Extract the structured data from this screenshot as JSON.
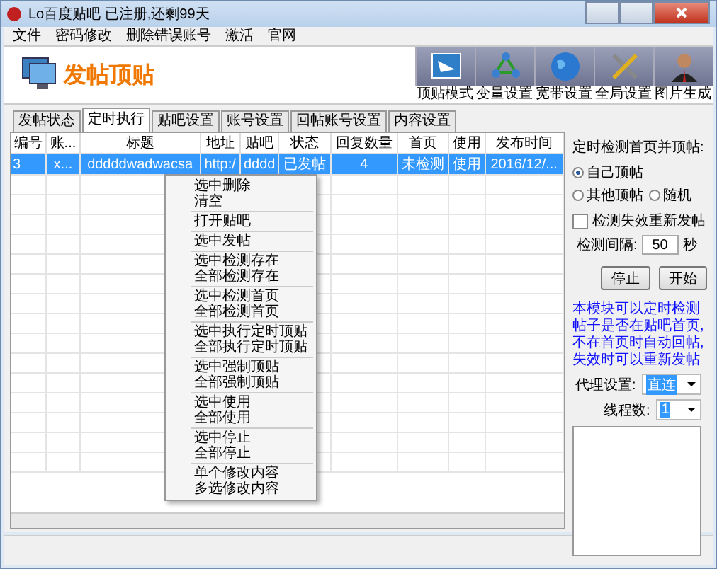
{
  "window": {
    "title": "Lo百度贴吧  已注册,还剩99天"
  },
  "menu": [
    "文件",
    "密码修改",
    "删除错误账号",
    "激活",
    "官网"
  ],
  "header": {
    "title": "发帖顶贴"
  },
  "toolbar": [
    {
      "label": "顶贴模式",
      "kind": "screen"
    },
    {
      "label": "变量设置",
      "kind": "network"
    },
    {
      "label": "宽带设置",
      "kind": "globe"
    },
    {
      "label": "全局设置",
      "kind": "tools"
    },
    {
      "label": "图片生成",
      "kind": "person"
    }
  ],
  "tabs": [
    {
      "label": "发帖状态",
      "selected": false
    },
    {
      "label": "定时执行",
      "selected": true
    },
    {
      "label": "贴吧设置",
      "selected": false
    },
    {
      "label": "账号设置",
      "selected": false
    },
    {
      "label": "回帖账号设置",
      "selected": false
    },
    {
      "label": "内容设置",
      "selected": false
    }
  ],
  "table": {
    "columns": [
      "编号",
      "账...",
      "标题",
      "地址",
      "贴吧",
      "状态",
      "回复数量",
      "首页",
      "使用",
      "发布时间"
    ],
    "rows": [
      {
        "selected": true,
        "cells": [
          "3",
          "x...",
          "dddddwadwacsa",
          "http:/",
          "dddd",
          "已发帖",
          "4",
          "未检测",
          "使用",
          "2016/12/..."
        ]
      }
    ]
  },
  "context_menu": [
    [
      "选中删除",
      "清空"
    ],
    [
      "打开贴吧"
    ],
    [
      "选中发帖"
    ],
    [
      "选中检测存在",
      "全部检测存在"
    ],
    [
      "选中检测首页",
      "全部检测首页"
    ],
    [
      "选中执行定时顶贴",
      "全部执行定时顶贴"
    ],
    [
      "选中强制顶贴",
      "全部强制顶贴"
    ],
    [
      "选中使用",
      "全部使用"
    ],
    [
      "选中停止",
      "全部停止"
    ],
    [
      "单个修改内容",
      "多选修改内容"
    ]
  ],
  "panel": {
    "heading": "定时检测首页并顶帖:",
    "radios": [
      {
        "label": "自己顶帖",
        "selected": true
      },
      {
        "label": "其他顶帖",
        "selected": false
      },
      {
        "label": "随机",
        "selected": false
      }
    ],
    "checkbox": {
      "label": "检测失效重新发帖",
      "checked": false
    },
    "interval": {
      "label": "检测间隔:",
      "value": "50",
      "unit": "秒"
    },
    "buttons": [
      "停止",
      "开始"
    ],
    "note": "本模块可以定时检测帖子是否在贴吧首页,不在首页时自动回帖,失效时可以重新发帖",
    "proxy": {
      "label": "代理设置:",
      "value": "直连"
    },
    "threads": {
      "label": "线程数:",
      "value": "1"
    }
  }
}
